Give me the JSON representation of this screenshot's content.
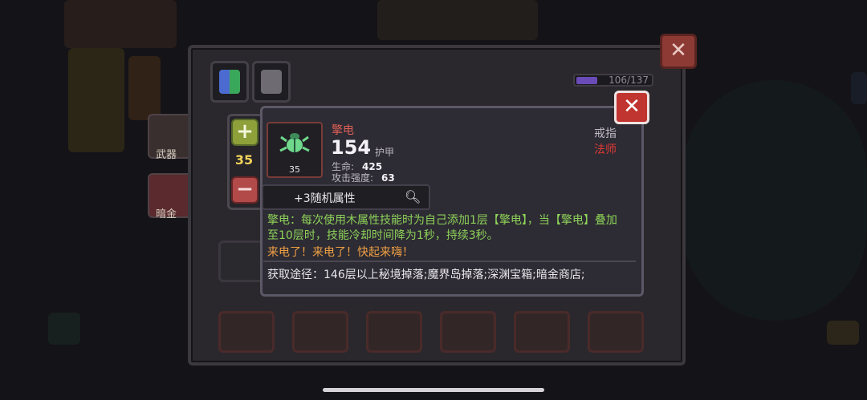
{
  "background": {
    "weapon_label": "武器",
    "gold_label": "暗金"
  },
  "inventory": {
    "capacity_text": "106/137",
    "capacity_fraction": 0.77,
    "close_symbol": "✕"
  },
  "stepper": {
    "plus_symbol": "+",
    "minus_symbol": "−",
    "value": "35"
  },
  "item": {
    "name": "擎电",
    "level": "35",
    "armor_value": "154",
    "armor_label": "护甲",
    "stats": [
      {
        "label": "生命:",
        "value": "425"
      },
      {
        "label": "攻击强度:",
        "value": "63"
      }
    ],
    "type": "戒指",
    "class": "法师",
    "random_attributes": "+3随机属性",
    "description": "擎电：每次使用木属性技能时为自己添加1层【擎电】，当【擎电】叠加至10层时，技能冷却时间降为1秒，持续3秒。",
    "flavor": "来电了！来电了！快起来嗨！",
    "source": "获取途径：146层以上秘境掉落;魔界岛掉落;深渊宝箱;暗金商店;",
    "close_symbol": "✕",
    "icon": "beetle-ring-icon"
  },
  "colors": {
    "name": "#e06058",
    "description": "#8ed35a",
    "flavor": "#f0a044",
    "class": "#e03a35",
    "close": "#c0352f"
  }
}
